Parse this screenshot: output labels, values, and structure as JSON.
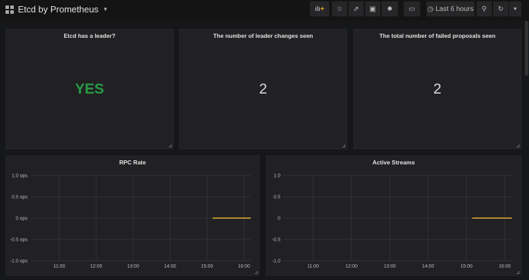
{
  "header": {
    "title": "Etcd by Prometheus",
    "time_range": "Last 6 hours"
  },
  "toolbar": {
    "icons": [
      "add-panel-icon",
      "star-icon",
      "share-icon",
      "save-icon",
      "gear-icon",
      "tv-icon",
      "clock-icon",
      "zoom-out-icon",
      "refresh-icon",
      "caret-down-icon"
    ]
  },
  "stats": [
    {
      "title": "Etcd has a leader?",
      "value": "YES",
      "color": "#299c46"
    },
    {
      "title": "The number of leader changes seen",
      "value": "2",
      "color": "#d8d9da"
    },
    {
      "title": "The total number of failed proposals seen",
      "value": "2",
      "color": "#d8d9da"
    }
  ],
  "chart_data": [
    {
      "type": "line",
      "title": "RPC Rate",
      "yticks": [
        "1.0 ops",
        "0.5 ops",
        "0 ops",
        "-0.5 ops",
        "-1.0 ops"
      ],
      "ylim": [
        -1,
        1
      ],
      "xticks": [
        "11:00",
        "12:00",
        "13:00",
        "14:00",
        "15:00",
        "16:00"
      ],
      "xlim": [
        "10:13",
        "16:11"
      ],
      "grid": true,
      "series": [
        {
          "color": "#eab839",
          "x": [
            "15:09",
            "16:11"
          ],
          "y": [
            0,
            0
          ]
        }
      ]
    },
    {
      "type": "line",
      "title": "Active Streams",
      "yticks": [
        "1.0",
        "0.5",
        "0",
        "-0.5",
        "-1.0"
      ],
      "ylim": [
        -1,
        1
      ],
      "xticks": [
        "11:00",
        "12:00",
        "13:00",
        "14:00",
        "15:00",
        "16:00"
      ],
      "xlim": [
        "10:13",
        "16:11"
      ],
      "grid": true,
      "series": [
        {
          "color": "#eab839",
          "x": [
            "15:09",
            "16:11"
          ],
          "y": [
            0,
            0
          ]
        }
      ]
    }
  ]
}
